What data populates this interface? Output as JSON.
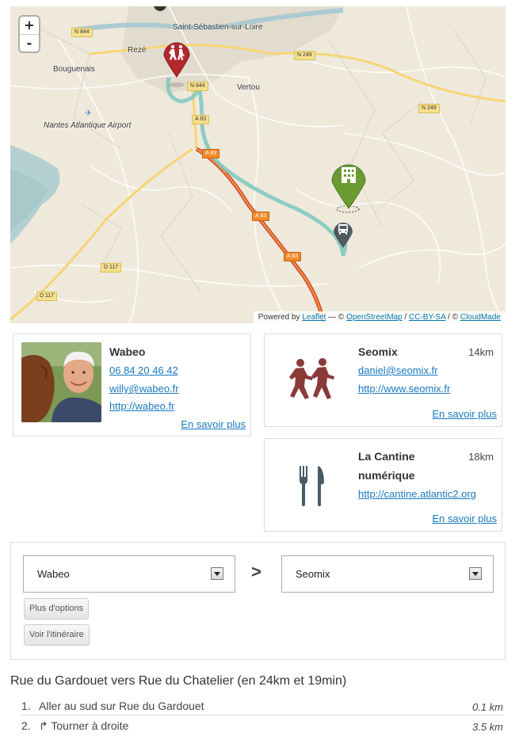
{
  "map": {
    "zoom_in": "+",
    "zoom_out": "-",
    "places": {
      "saint_sebastien": "Saint-Sébastien-sur-Loire",
      "reze": "Rezé",
      "bouguenais": "Bouguenais",
      "vertou": "Vertou",
      "airport": "Nantes Atlantique Airport"
    },
    "roads": {
      "n844_top": "N 844",
      "n844_mid": "N 844",
      "n249_a": "N 249",
      "n249_b": "N 249",
      "a83_1": "A 83",
      "a83_2": "A 83",
      "a83_3": "A 83",
      "a83_4": "A 83",
      "d117_a": "D 117",
      "d117_b": "D 117"
    },
    "attribution": {
      "powered": "Powered by ",
      "leaflet": "Leaflet",
      "sep1": " — © ",
      "osm": "OpenStreetMap",
      "sep2": " / ",
      "license": "CC-BY-SA",
      "sep3": " / © ",
      "cloudmade": "CloudMade"
    },
    "colors": {
      "route": "#7ec8c0",
      "marker_school": "#b3282d",
      "marker_building": "#6a9a32",
      "marker_bus": "#505a60"
    },
    "icons": [
      "children-icon",
      "building-icon",
      "bus-icon"
    ]
  },
  "cards": {
    "wabeo": {
      "name": "Wabeo",
      "phone": "06 84 20 46 42",
      "email": "willy@wabeo.fr",
      "url": "http://wabeo.fr",
      "more": "En savoir plus"
    },
    "seomix": {
      "name": "Seomix",
      "distance": "14km",
      "email": "daniel@seomix.fr",
      "url": "http://www.seomix.fr",
      "more": "En savoir plus",
      "icon": "children-icon",
      "icon_color": "#8b3a3a"
    },
    "cantine": {
      "name_line1": "La Cantine",
      "name_line2": "numérique",
      "distance": "18km",
      "url": "http://cantine.atlantic2.org",
      "more": "En savoir plus",
      "icon": "fork-knife-icon",
      "icon_color": "#4a5a64"
    }
  },
  "form": {
    "from_value": "Wabeo",
    "separator": ">",
    "to_value": "Seomix",
    "options_button": "Plus d'options",
    "route_button": "Voir l'itinéraire"
  },
  "route": {
    "title": "Rue du Gardouet vers Rue du Chatelier (en 24km et 19min)",
    "steps": [
      {
        "num": "1.",
        "text": "Aller au sud sur Rue du Gardouet",
        "distance": "0.1 km"
      },
      {
        "num": "2.",
        "text": "↱ Tourner à droite",
        "distance": "3.5 km"
      }
    ]
  }
}
